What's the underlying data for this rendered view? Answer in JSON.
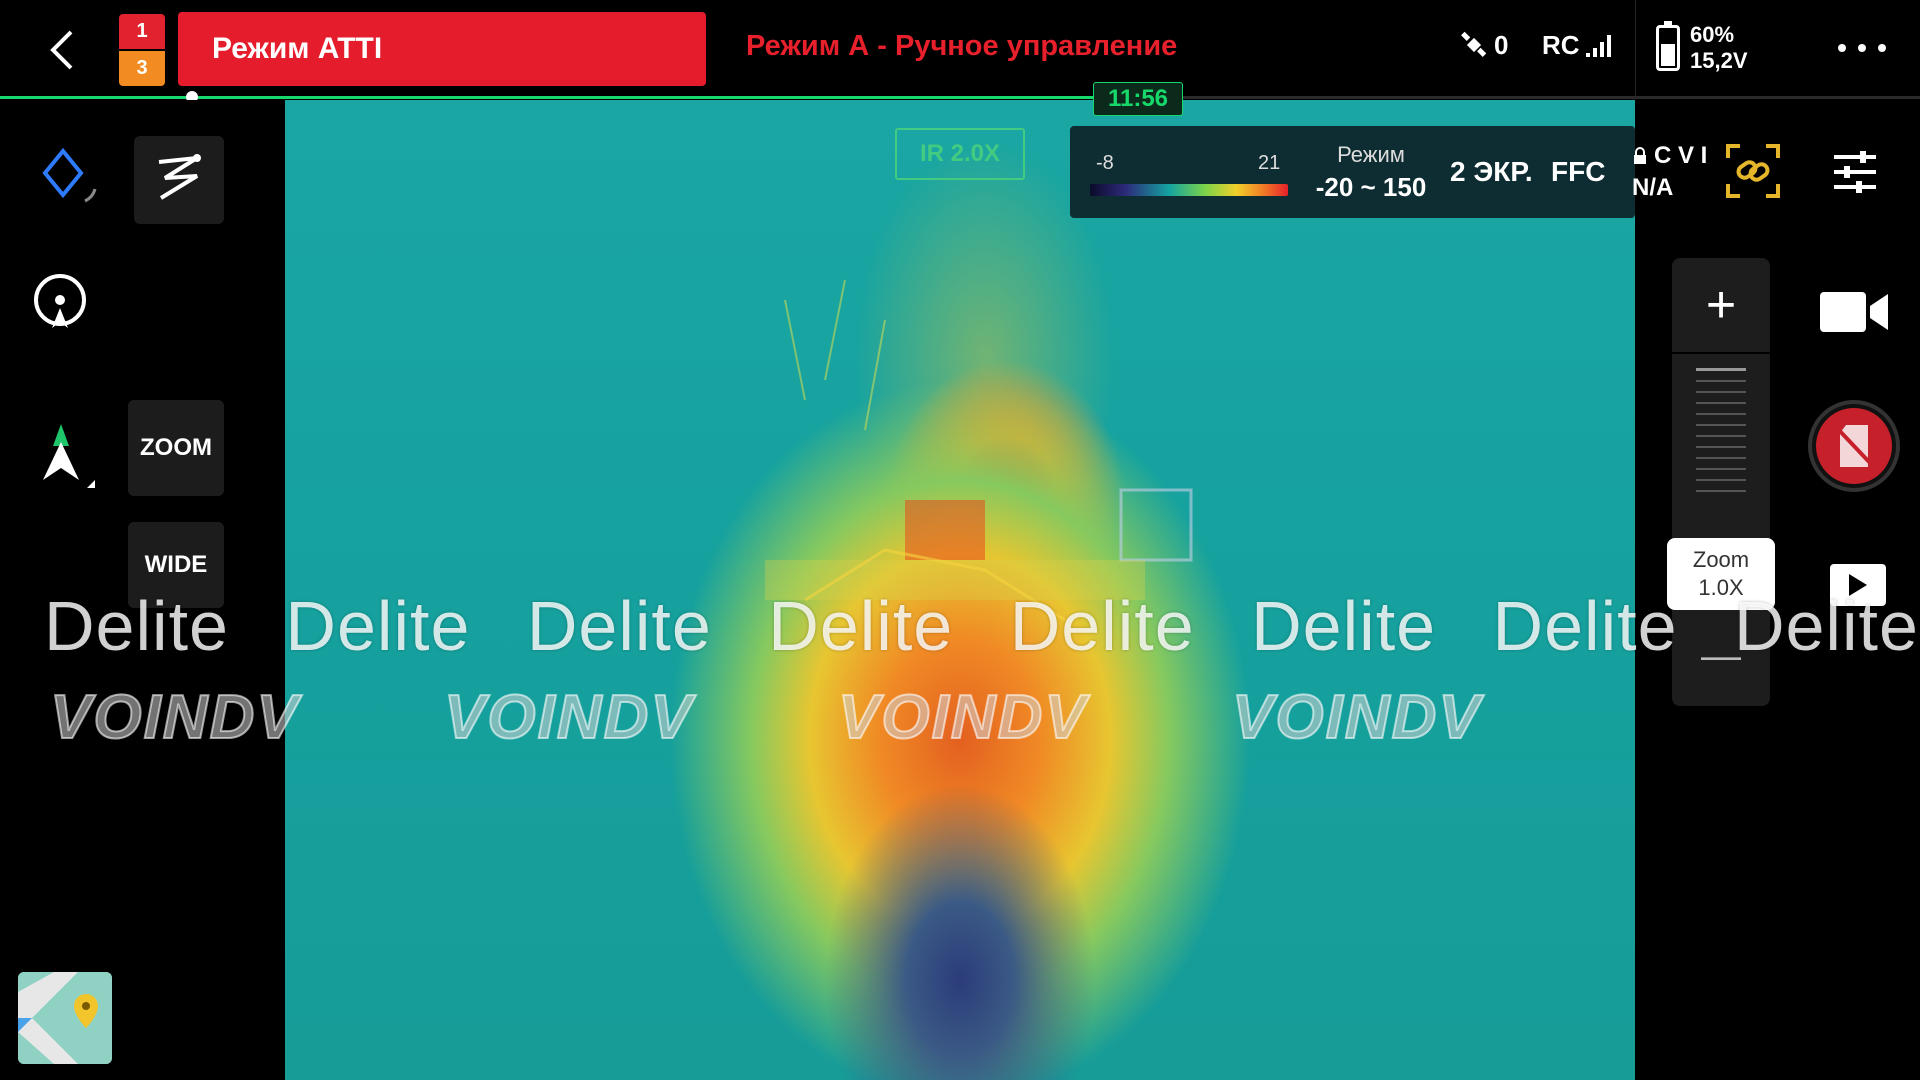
{
  "top_bar": {
    "back_icon": "chevron-left-icon",
    "warnings": {
      "top_count": "1",
      "bottom_count": "3",
      "top_color": "#e0232e",
      "bottom_color": "#f28c22"
    },
    "flight_mode": "Режим ATTI",
    "flight_mode_color": "#e51c2c",
    "mode_description": "Режим А - Ручное управление",
    "satellite_count": "0",
    "rc_label": "RC",
    "battery_percent": "60%",
    "battery_voltage": "15,2V",
    "battery_level": 0.6,
    "more_icon": "more-dots-icon"
  },
  "timeline": {
    "flight_time": "11:56",
    "accent_color": "#17d86b"
  },
  "left_panel": {
    "zoom_button": "ZOOM",
    "wide_button": "WIDE"
  },
  "camera": {
    "ir_zoom": "IR 2.0X",
    "palette_min": "-8",
    "palette_max": "21",
    "range_label": "Режим",
    "range_value": "-20 ~ 150",
    "screen_mode": "2 ЭКР.",
    "ffc_label": "FFC",
    "cvi_label": "C V I",
    "cvi_value": "N/A"
  },
  "zoom_control": {
    "plus_label": "+",
    "minus_label": "—",
    "readout_label": "Zoom",
    "readout_value": "1.0X"
  },
  "watermarks": {
    "text": "Delite",
    "logo_text": "VOINDV"
  }
}
